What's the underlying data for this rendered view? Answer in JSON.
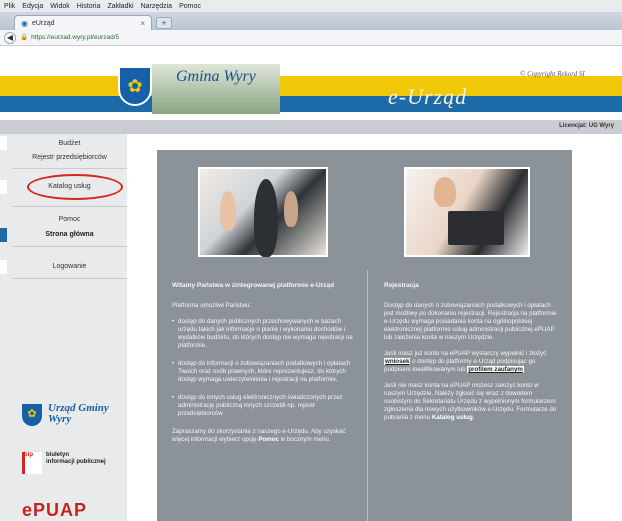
{
  "browser": {
    "menu": [
      "Plik",
      "Edycja",
      "Widok",
      "Historia",
      "Zakładki",
      "Narzędzia",
      "Pomoc"
    ],
    "tab_title": "eUrząd",
    "tab_close": "×",
    "new_tab": "+",
    "url": "https://eurzad.wyry.pl/eurzad/5"
  },
  "header": {
    "gmina_title": "Gmina Wyry",
    "eurzad_title": "e-Urząd",
    "copyright": "© Copyright Rekord SI",
    "licencja": "Licencjat: UG Wyry"
  },
  "sidebar": {
    "items": [
      {
        "label": "Budżet"
      },
      {
        "label": "Rejestr przedsiębiorców"
      },
      {
        "label": "Katalog usług"
      },
      {
        "label": "Pomoc"
      },
      {
        "label": "Strona główna"
      },
      {
        "label": "Logowanie"
      }
    ],
    "urzad_logo_line1": "Urząd Gminy",
    "urzad_logo_line2": "Wyry",
    "bip_label": "bip",
    "bip_line1": "biuletyn",
    "bip_line2": "informacji publicznej",
    "epuap": "ePUAP"
  },
  "content": {
    "left": {
      "heading": "Witamy Państwa w zintegrowanej platformie e-Urząd",
      "intro": "Platforma umożliwi Państwu:",
      "bullets": [
        "dostęp do danych publicznych przechowywanych w bazach urzędu takich jak informacje o planie i wykonaniu dochodów i wydatków budżetu, do których dostęp nie wymaga rejestracji na platformie,",
        "dostęp do informacji o zobowiązaniach podatkowych i opłatach Twoich oraz osób prawnych, które reprezentujesz, do których dostęp wymaga uwierzytelnienia i rejestracji na platformie,",
        "dostęp do innych usług elektronicznych świadczonych przez administrację publiczną innych szczebli np. rejestr przedsiębiorców"
      ],
      "closing_pre": "Zapraszamy do skorzystania z naszego e-Urzędu. Aby uzyskać więcej informacji wybierz opcję ",
      "closing_bold": "Pomoc",
      "closing_post": " w bocznym menu."
    },
    "right": {
      "heading": "Rejestracja",
      "p1": "Dostęp do danych o zobowiązaniach podatkowych i opłatach jest możliwy po dokonaniu rejestracji. Rejestracja na platformie e-Urzędu wymaga posiadania konta na ogólnopolskiej elektronicznej platformie usług administracji publicznej ePUAP lub założenia konta w naszym Urzędzie.",
      "p2_pre": "Jeśli masz już konto na ePUAP wystarczy wypełnić i złożyć ",
      "p2_hl1": "wniosek",
      "p2_mid": " o dostęp do platformy e-Urząd podpisując go podpisem kwalifikowanym lub ",
      "p2_hl2": "profilem zaufanym",
      "p3_pre": "Jeśli nie masz konta na ePUAP możesz założyć konto w naszym Urzędzie. Należy zgłosić się wraz z dowodem osobistym do Sekretariatu Urzędu z wypełnionym formularzem zgłoszenia dla nowych użytkowników e-Urzędu. Formularze do pobrania z menu ",
      "p3_bold": "Katalog usług",
      "p3_post": "."
    }
  },
  "colors": {
    "header_yellow": "#f0c808",
    "header_blue": "#1d6aa8",
    "panel_gray": "#8b9399",
    "highlight_red": "#d3261e"
  }
}
